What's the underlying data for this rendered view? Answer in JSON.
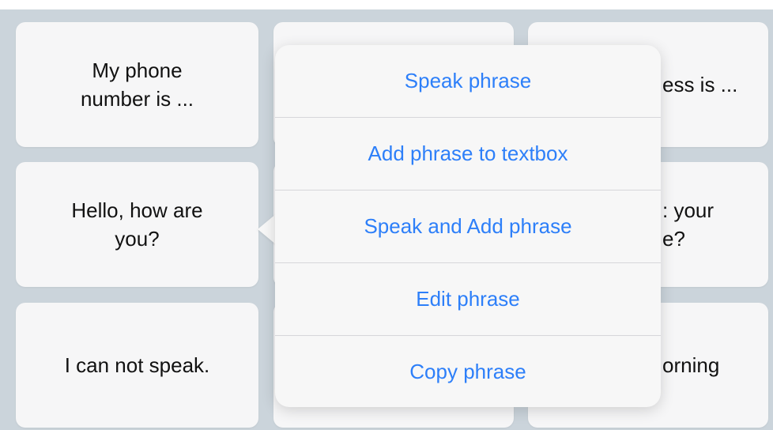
{
  "tiles": {
    "t1": "My phone\nnumber is ...",
    "t2": "",
    "t3": "ess is ...",
    "t4": "Hello, how are\nyou?",
    "t5": "",
    "t6": ": your\ne?",
    "t7": "I can not speak.",
    "t8": "",
    "t9": "orning"
  },
  "context_menu": {
    "items": [
      {
        "label": "Speak phrase"
      },
      {
        "label": "Add phrase to textbox"
      },
      {
        "label": "Speak and Add phrase"
      },
      {
        "label": "Edit phrase"
      },
      {
        "label": "Copy phrase"
      }
    ]
  },
  "colors": {
    "background": "#cbd4db",
    "tile": "#f6f6f7",
    "menu": "#f7f7f7",
    "accent": "#2d7ff9",
    "text": "#111111"
  }
}
